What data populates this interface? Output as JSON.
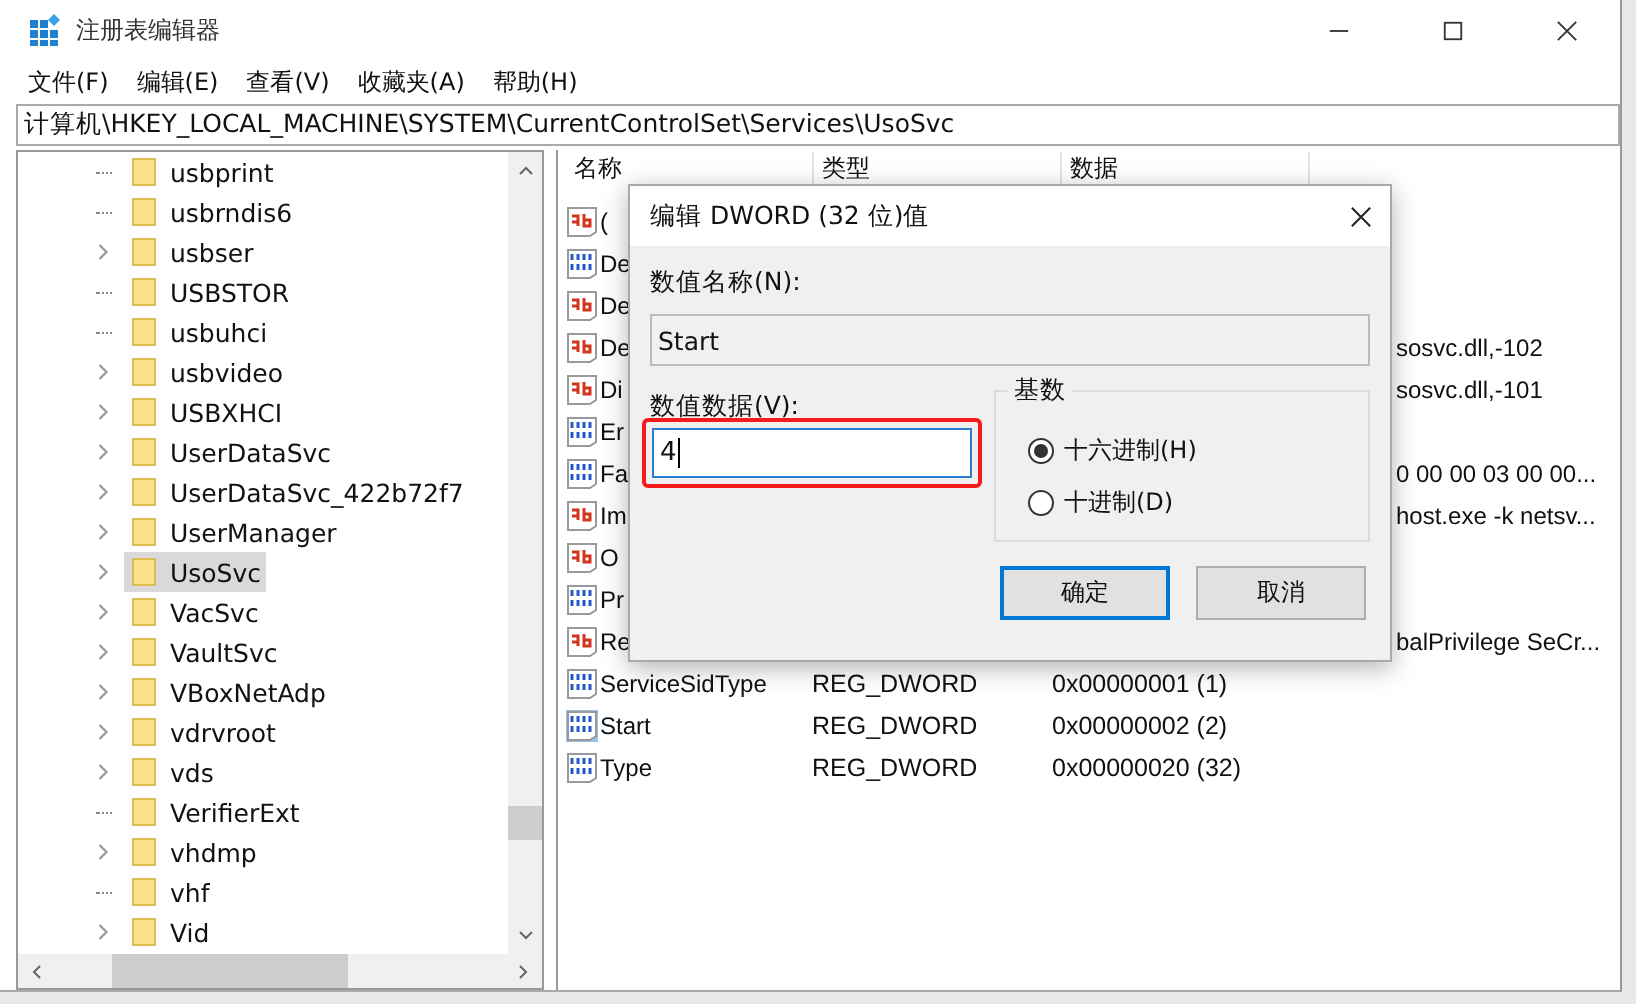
{
  "window": {
    "title": "注册表编辑器"
  },
  "menu": [
    "文件(F)",
    "编辑(E)",
    "查看(V)",
    "收藏夹(A)",
    "帮助(H)"
  ],
  "address": "计算机\\HKEY_LOCAL_MACHINE\\SYSTEM\\CurrentControlSet\\Services\\UsoSvc",
  "tree": [
    {
      "label": "usbprint",
      "expandable": false,
      "selected": false
    },
    {
      "label": "usbrndis6",
      "expandable": false,
      "selected": false
    },
    {
      "label": "usbser",
      "expandable": true,
      "selected": false
    },
    {
      "label": "USBSTOR",
      "expandable": false,
      "selected": false
    },
    {
      "label": "usbuhci",
      "expandable": false,
      "selected": false
    },
    {
      "label": "usbvideo",
      "expandable": true,
      "selected": false
    },
    {
      "label": "USBXHCI",
      "expandable": true,
      "selected": false
    },
    {
      "label": "UserDataSvc",
      "expandable": true,
      "selected": false
    },
    {
      "label": "UserDataSvc_422b72f7",
      "expandable": true,
      "selected": false
    },
    {
      "label": "UserManager",
      "expandable": true,
      "selected": false
    },
    {
      "label": "UsoSvc",
      "expandable": true,
      "selected": true
    },
    {
      "label": "VacSvc",
      "expandable": true,
      "selected": false
    },
    {
      "label": "VaultSvc",
      "expandable": true,
      "selected": false
    },
    {
      "label": "VBoxNetAdp",
      "expandable": true,
      "selected": false
    },
    {
      "label": "vdrvroot",
      "expandable": true,
      "selected": false
    },
    {
      "label": "vds",
      "expandable": true,
      "selected": false
    },
    {
      "label": "VerifierExt",
      "expandable": false,
      "selected": false
    },
    {
      "label": "vhdmp",
      "expandable": true,
      "selected": false
    },
    {
      "label": "vhf",
      "expandable": false,
      "selected": false
    },
    {
      "label": "Vid",
      "expandable": true,
      "selected": false
    }
  ],
  "columns": [
    "名称",
    "类型",
    "数据"
  ],
  "rows": [
    {
      "kind": "string",
      "name": "(",
      "selected": false
    },
    {
      "kind": "binary",
      "name": "De",
      "selected": false
    },
    {
      "kind": "string",
      "name": "De",
      "selected": false
    },
    {
      "kind": "string",
      "name": "De",
      "data_tail": "sosvc.dll,-102",
      "selected": false
    },
    {
      "kind": "string",
      "name": "Di",
      "data_tail": "sosvc.dll,-101",
      "selected": false
    },
    {
      "kind": "binary",
      "name": "Er",
      "selected": false
    },
    {
      "kind": "binary",
      "name": "Fa",
      "data_tail": "0 00 00 03 00 00...",
      "selected": false
    },
    {
      "kind": "string",
      "name": "Im",
      "data_tail": "host.exe -k netsv...",
      "selected": false
    },
    {
      "kind": "string",
      "name": "O",
      "selected": false
    },
    {
      "kind": "binary",
      "name": "Pr",
      "selected": false
    },
    {
      "kind": "string",
      "name": "Re",
      "data_tail": "balPrivilege SeCr...",
      "selected": false
    },
    {
      "kind": "binary",
      "name": "ServiceSidType",
      "type": "REG_DWORD",
      "data": "0x00000001 (1)",
      "selected": false
    },
    {
      "kind": "binary",
      "name": "Start",
      "type": "REG_DWORD",
      "data": "0x00000002 (2)",
      "selected": true
    },
    {
      "kind": "binary",
      "name": "Type",
      "type": "REG_DWORD",
      "data": "0x00000020 (32)",
      "selected": false
    }
  ],
  "dialog": {
    "title": "编辑 DWORD (32 位)值",
    "name_label": "数值名称(N):",
    "name_value": "Start",
    "data_label": "数值数据(V):",
    "data_value": "4",
    "highlighted": true,
    "base_label": "基数",
    "radios": [
      {
        "label": "十六进制(H)",
        "selected": true
      },
      {
        "label": "十进制(D)",
        "selected": false
      }
    ],
    "ok": "确定",
    "cancel": "取消"
  }
}
